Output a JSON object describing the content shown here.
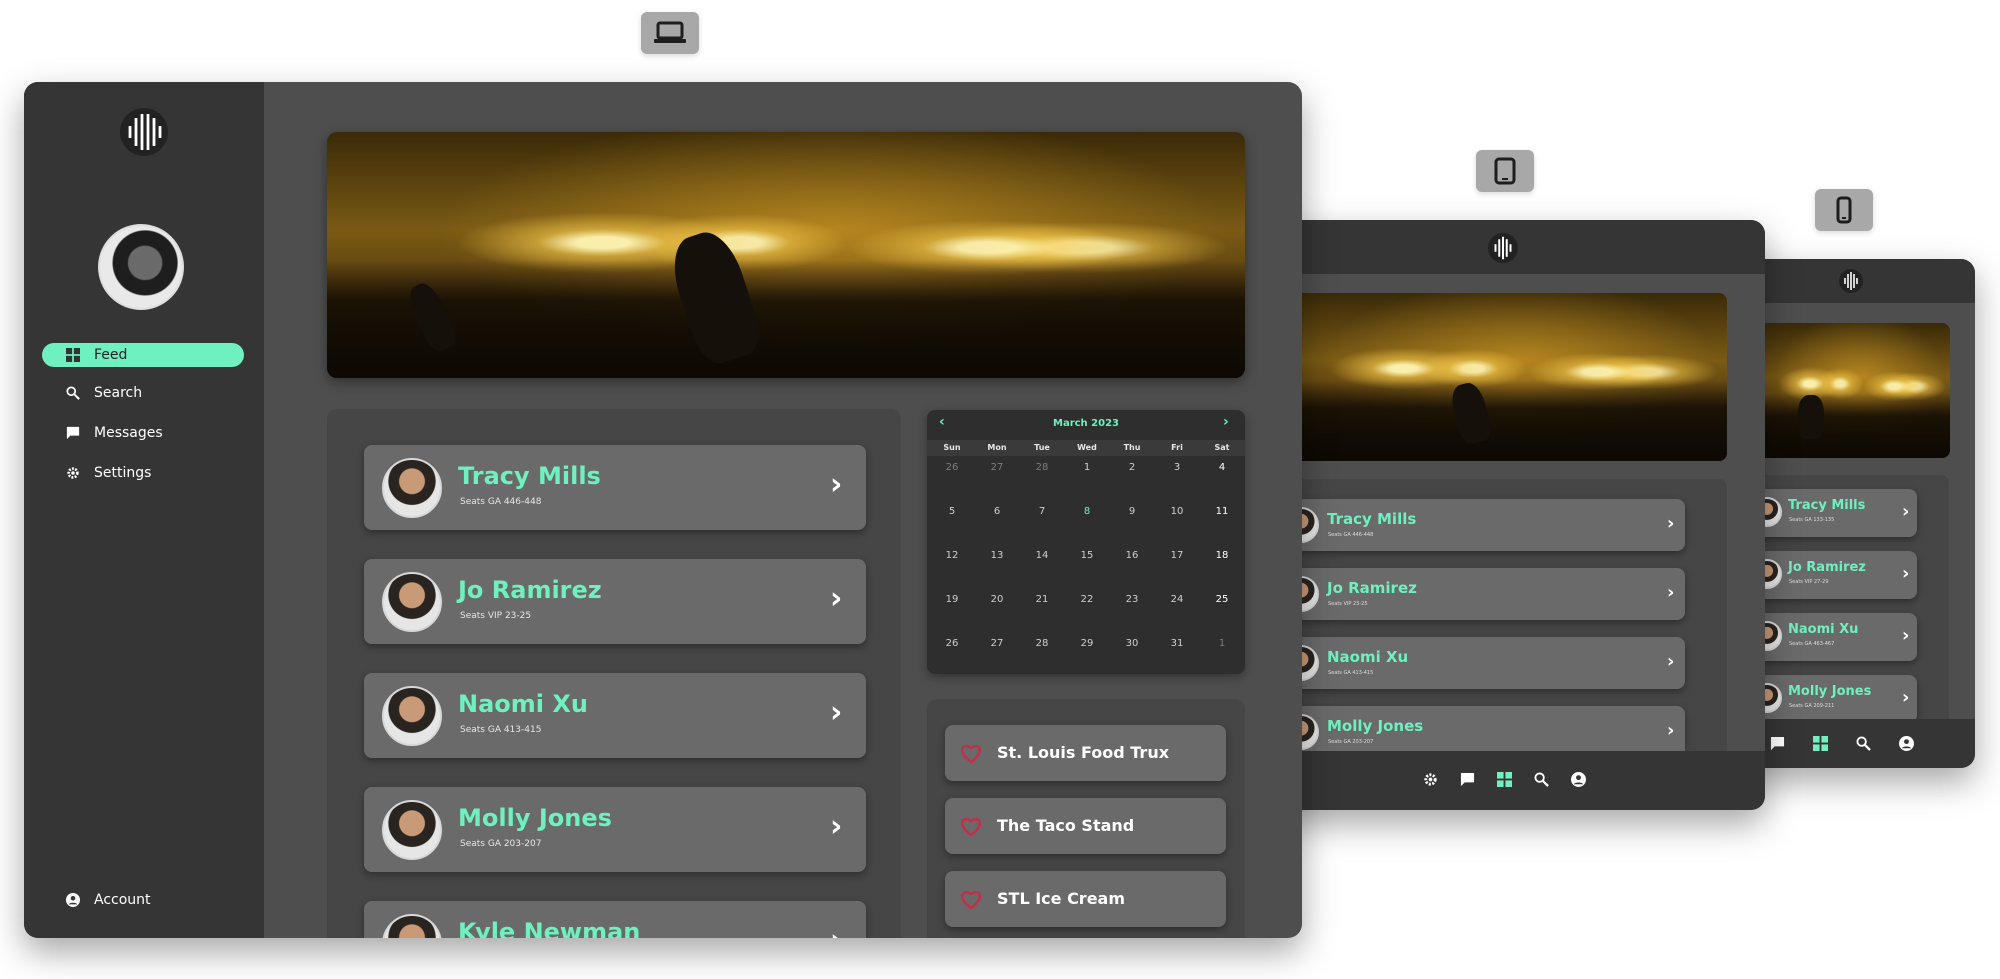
{
  "sidebar": {
    "nav": [
      {
        "label": "Feed",
        "icon": "grid-icon",
        "active": true
      },
      {
        "label": "Search",
        "icon": "search-icon"
      },
      {
        "label": "Messages",
        "icon": "message-icon"
      },
      {
        "label": "Settings",
        "icon": "gear-icon"
      }
    ],
    "account_label": "Account"
  },
  "people": [
    {
      "name": "Tracy Mills",
      "seats": "Seats GA 446-448"
    },
    {
      "name": "Jo Ramirez",
      "seats": "Seats VIP 23-25"
    },
    {
      "name": "Naomi Xu",
      "seats": "Seats GA 413-415"
    },
    {
      "name": "Molly Jones",
      "seats": "Seats GA 203-207"
    },
    {
      "name": "Kyle Newman",
      "seats": ""
    }
  ],
  "tablet_people": [
    {
      "name": "Tracy Mills",
      "seats": "Seats GA 446-448"
    },
    {
      "name": "Jo Ramirez",
      "seats": "Seats VIP 23-25"
    },
    {
      "name": "Naomi Xu",
      "seats": "Seats GA 413-415"
    },
    {
      "name": "Molly Jones",
      "seats": "Seats GA 203-207"
    }
  ],
  "phone_people": [
    {
      "name": "Tracy Mills",
      "seats": "Seats GA 133-135"
    },
    {
      "name": "Jo Ramirez",
      "seats": "Seats VIP 27-29"
    },
    {
      "name": "Naomi Xu",
      "seats": "Seats GA 463-467"
    },
    {
      "name": "Molly Jones",
      "seats": "Seats GA 209-211"
    }
  ],
  "calendar": {
    "month": "March 2023",
    "prev": "‹",
    "next": "›",
    "weekdays": [
      "Sun",
      "Mon",
      "Tue",
      "Wed",
      "Thu",
      "Fri",
      "Sat"
    ],
    "weeks": [
      [
        "26",
        "27",
        "28",
        "1",
        "2",
        "3",
        "4"
      ],
      [
        "5",
        "6",
        "7",
        "8",
        "9",
        "10",
        "11"
      ],
      [
        "12",
        "13",
        "14",
        "15",
        "16",
        "17",
        "18"
      ],
      [
        "19",
        "20",
        "21",
        "22",
        "23",
        "24",
        "25"
      ],
      [
        "26",
        "27",
        "28",
        "29",
        "30",
        "31",
        "1"
      ]
    ],
    "today": "8",
    "colors": {
      "accent": "#6ff0c0"
    }
  },
  "favorites": [
    {
      "label": "St. Louis Food Trux"
    },
    {
      "label": "The Taco Stand"
    },
    {
      "label": "STL Ice Cream"
    }
  ],
  "colors": {
    "accent": "#6ff0c0",
    "sidebar": "#353535",
    "panel": "#4e4e4e",
    "heart": "#c0304a"
  }
}
